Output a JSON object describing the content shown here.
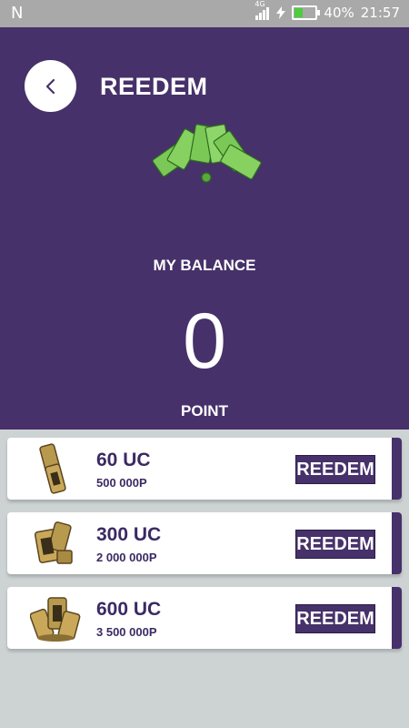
{
  "status_bar": {
    "notification_letter": "N",
    "network_type": "4G",
    "battery_percent": "40%",
    "battery_level": 0.4,
    "time": "21:57"
  },
  "header": {
    "title": "REEDEM",
    "balance_label": "MY BALANCE",
    "balance_value": "0",
    "point_label": "POINT",
    "back_icon": "chevron-left-icon",
    "hero_icon": "cash-stack-icon"
  },
  "offers": [
    {
      "uc": "60 UC",
      "points": "500 000P",
      "button": "REEDEM",
      "icon": "uc-pack-small-icon"
    },
    {
      "uc": "300 UC",
      "points": "2 000 000P",
      "button": "REEDEM",
      "icon": "uc-pack-medium-icon"
    },
    {
      "uc": "600 UC",
      "points": "3 500 000P",
      "button": "REEDEM",
      "icon": "uc-pack-large-icon"
    }
  ],
  "colors": {
    "primary": "#46316a",
    "background": "#cdd2d2",
    "status_bar": "#a9a9a9",
    "battery_fill": "#4ccd3b"
  }
}
